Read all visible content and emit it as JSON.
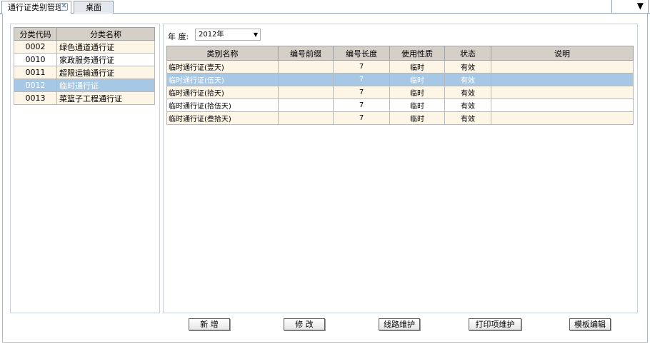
{
  "tabs": [
    {
      "label": "通行证类别管理",
      "active": true
    },
    {
      "label": "桌面",
      "active": false
    }
  ],
  "tab_dropdown_glyph": "▼",
  "left_panel": {
    "columns": [
      "分类代码",
      "分类名称"
    ],
    "rows": [
      {
        "code": "0002",
        "name": "绿色通道通行证"
      },
      {
        "code": "0010",
        "name": "家政服务通行证"
      },
      {
        "code": "0011",
        "name": "超限运输通行证"
      },
      {
        "code": "0012",
        "name": "临时通行证"
      },
      {
        "code": "0013",
        "name": "菜篮子工程通行证"
      }
    ]
  },
  "filter": {
    "year_label": "年  度:",
    "year_value": "2012年"
  },
  "right_panel": {
    "columns": [
      "类别名称",
      "编号前缀",
      "编号长度",
      "使用性质",
      "状态",
      "说明"
    ],
    "rows": [
      {
        "name": "临时通行证(壹天)",
        "prefix": "",
        "length": "7",
        "nature": "临时",
        "status": "有效",
        "desc": ""
      },
      {
        "name": "临时通行证(伍天)",
        "prefix": "",
        "length": "7",
        "nature": "临时",
        "status": "有效",
        "desc": ""
      },
      {
        "name": "临时通行证(拾天)",
        "prefix": "",
        "length": "7",
        "nature": "临时",
        "status": "有效",
        "desc": ""
      },
      {
        "name": "临时通行证(拾伍天)",
        "prefix": "",
        "length": "7",
        "nature": "临时",
        "status": "有效",
        "desc": ""
      },
      {
        "name": "临时通行证(叁拾天)",
        "prefix": "",
        "length": "7",
        "nature": "临时",
        "status": "有效",
        "desc": ""
      }
    ]
  },
  "buttons": {
    "add": "新 增",
    "edit": "修 改",
    "route": "线路维护",
    "print": "打印项维护",
    "template": "模板编辑"
  },
  "colors": {
    "selected_row": "#a6c8e4",
    "alt_row": "#fdf5e6",
    "header_bg": "#d4d0c8"
  }
}
